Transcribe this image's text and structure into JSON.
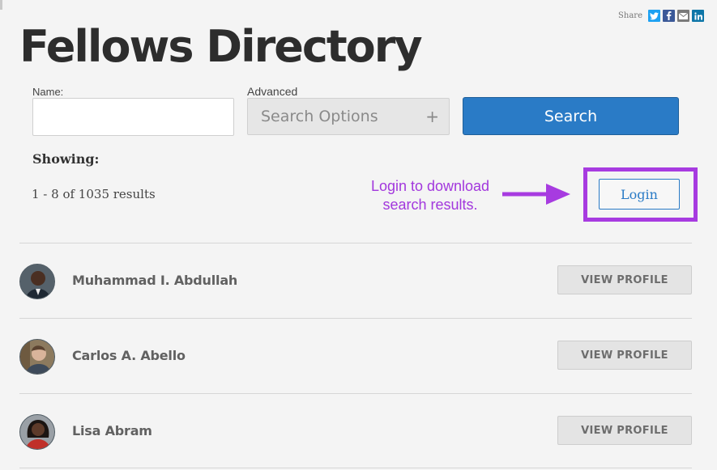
{
  "share": {
    "label": "Share",
    "buttons": [
      {
        "network": "twitter",
        "icon": "twitter-icon",
        "color": "#1da1f2"
      },
      {
        "network": "facebook",
        "icon": "facebook-icon",
        "color": "#3b5998"
      },
      {
        "network": "email",
        "icon": "email-icon",
        "color": "#7a7a7a"
      },
      {
        "network": "linkedin",
        "icon": "linkedin-icon",
        "color": "#0e76a8"
      }
    ]
  },
  "header": {
    "title": "Fellows Directory"
  },
  "search_form": {
    "name_label": "Name:",
    "name_value": "",
    "name_placeholder": "",
    "advanced_label": "Advanced",
    "advanced_button": "Search Options",
    "advanced_plus": "+",
    "search_button": "Search"
  },
  "results": {
    "showing_label": "Showing:",
    "count_text": "1 - 8 of 1035 results"
  },
  "annotation": {
    "text_line1": "Login to download",
    "text_line2": "search results.",
    "color": "#a73be0"
  },
  "login": {
    "button": "Login"
  },
  "fellows": [
    {
      "name": "Muhammad I. Abdullah",
      "action": "VIEW PROFILE"
    },
    {
      "name": "Carlos A. Abello",
      "action": "VIEW PROFILE"
    },
    {
      "name": "Lisa Abram",
      "action": "VIEW PROFILE"
    }
  ],
  "colors": {
    "primary": "#2a7bc6",
    "background": "#f4f4f4",
    "title": "#2d2d2d"
  }
}
